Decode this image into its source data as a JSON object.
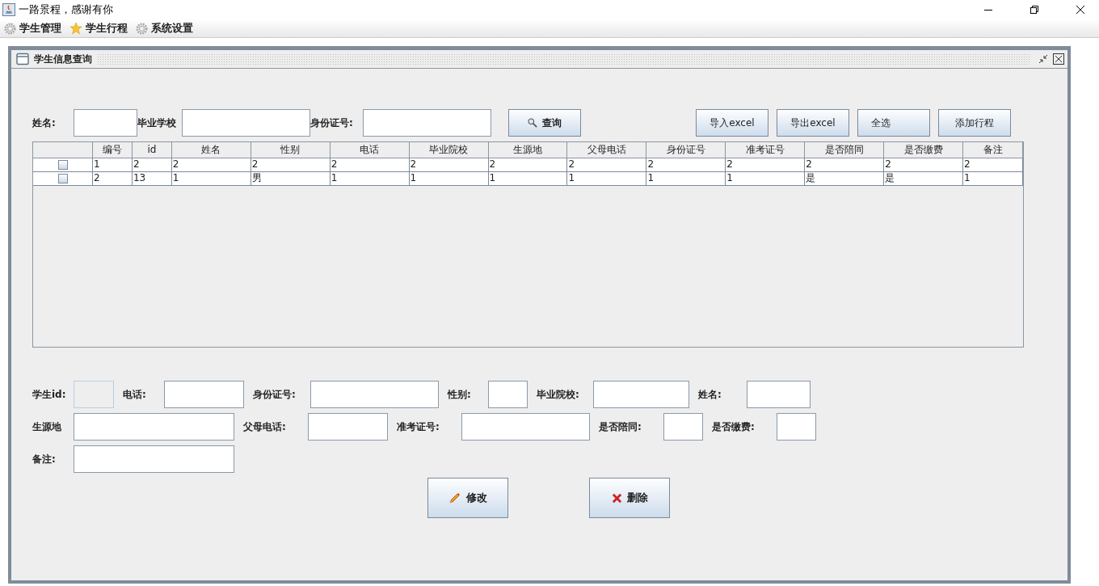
{
  "window": {
    "title": "一路景程，感谢有你"
  },
  "menu": [
    {
      "label": "学生管理",
      "kind": "gear"
    },
    {
      "label": "学生行程",
      "kind": "star"
    },
    {
      "label": "系统设置",
      "kind": "gear"
    }
  ],
  "frame": {
    "title": "学生信息查询"
  },
  "search": {
    "fields": [
      {
        "label": "姓名:"
      },
      {
        "label": "毕业学校"
      },
      {
        "label": "身份证号:"
      }
    ],
    "button": "查询"
  },
  "actions": [
    "导入excel",
    "导出excel",
    "全选",
    "添加行程"
  ],
  "table": {
    "columns": [
      "",
      "编号",
      "id",
      "姓名",
      "性别",
      "电话",
      "毕业院校",
      "生源地",
      "父母电话",
      "身份证号",
      "准考证号",
      "是否陪同",
      "是否缴费",
      "备注"
    ],
    "rows": [
      {
        "checked": false,
        "cells": [
          "1",
          "2",
          "2",
          "2",
          "2",
          "2",
          "2",
          "2",
          "2",
          "2",
          "2",
          "2",
          "2"
        ]
      },
      {
        "checked": false,
        "cells": [
          "2",
          "13",
          "1",
          "男",
          "1",
          "1",
          "1",
          "1",
          "1",
          "1",
          "是",
          "是",
          "1"
        ]
      }
    ]
  },
  "form": [
    [
      {
        "label": "学生id:",
        "disabled": true
      },
      {
        "label": "电话:",
        "disabled": false
      },
      {
        "label": "身份证号:",
        "disabled": false
      },
      {
        "label": "性别:",
        "disabled": false
      },
      {
        "label": "毕业院校:",
        "disabled": false
      },
      {
        "label": "姓名:",
        "disabled": false
      }
    ],
    [
      {
        "label": "生源地",
        "disabled": false
      },
      {
        "label": "父母电话:",
        "disabled": false
      },
      {
        "label": "准考证号:",
        "disabled": false
      },
      {
        "label": "是否陪同:",
        "disabled": false
      },
      {
        "label": "是否缴费:",
        "disabled": false
      }
    ],
    [
      {
        "label": "备注:",
        "disabled": false
      }
    ]
  ],
  "buttons": [
    {
      "label": "修改",
      "kind": "edit"
    },
    {
      "label": "删除",
      "kind": "delete"
    }
  ]
}
